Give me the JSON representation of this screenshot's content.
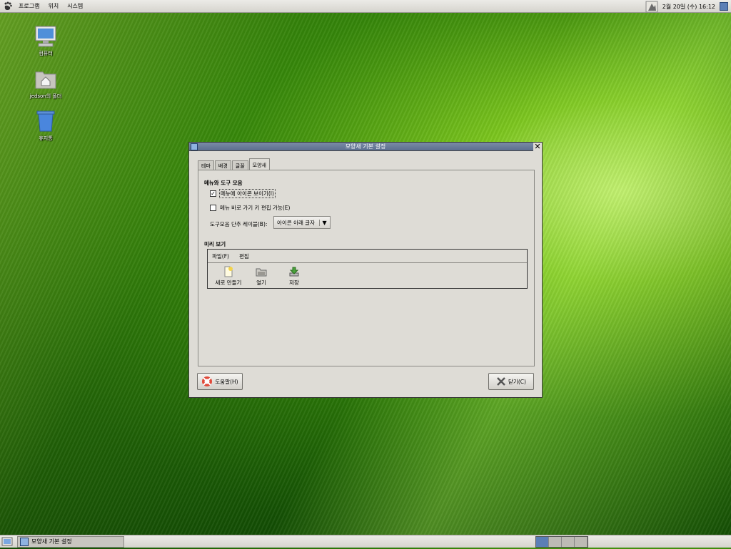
{
  "top_panel": {
    "menus": [
      "프로그램",
      "위치",
      "시스템"
    ],
    "clock": "2월 20일 (수) 16:12"
  },
  "desktop": {
    "icons": [
      {
        "label": "컴퓨터",
        "icon": "computer-icon"
      },
      {
        "label": "jedson의 폴더",
        "icon": "home-folder-icon"
      },
      {
        "label": "휴지통",
        "icon": "trash-icon"
      }
    ]
  },
  "window": {
    "title": "모양새 기본 설정",
    "tabs": [
      "테마",
      "배경",
      "글꼴",
      "모양새"
    ],
    "active_tab": "모양새",
    "section_menus": "메뉴와 도구 모음",
    "check_icons": {
      "label": "메뉴에 아이콘 보이기(I)",
      "checked": true
    },
    "check_shortcuts": {
      "label": "메뉴 바로 가기 키 편집 가능(E)",
      "checked": false
    },
    "toolbar_label_text": "도구모음 단추 레이블(B):",
    "toolbar_label_value": "아이콘 아래 글자",
    "section_preview": "미리 보기",
    "preview_menus": [
      "파일(F)",
      "편집"
    ],
    "preview_tools": [
      "새로 만들기",
      "열기",
      "저장"
    ],
    "help_button": "도움말(H)",
    "close_button": "닫기(C)"
  },
  "bottom_panel": {
    "task": "모양새 기본 설정"
  }
}
